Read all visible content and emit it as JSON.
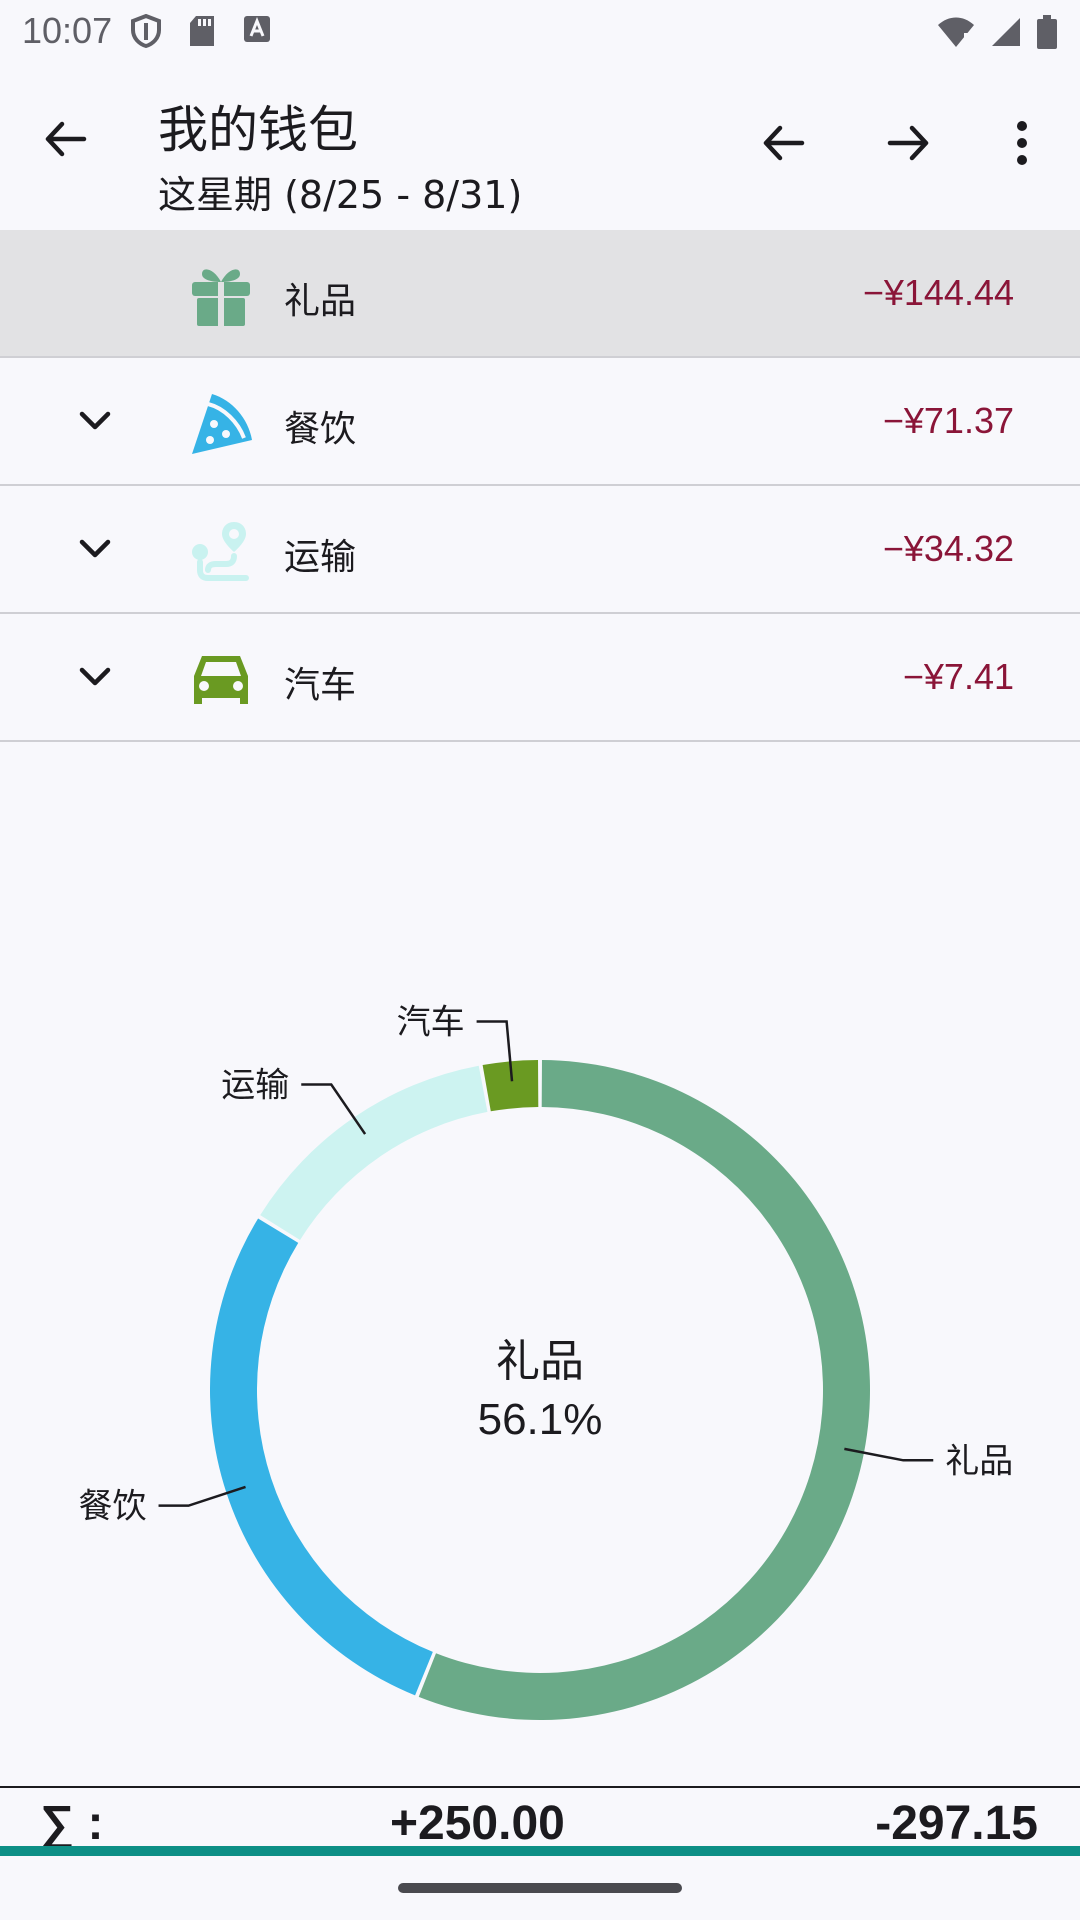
{
  "status_bar": {
    "time": "10:07"
  },
  "toolbar": {
    "title": "我的钱包",
    "subtitle": "这星期 (8/25 - 8/31)"
  },
  "categories": [
    {
      "name": "礼品",
      "amount": "−¥144.44",
      "icon": "gift-icon",
      "color": "#6aaa88",
      "selected": true,
      "expandable": false
    },
    {
      "name": "餐饮",
      "amount": "−¥71.37",
      "icon": "pizza-icon",
      "color": "#36b3e6",
      "selected": false,
      "expandable": true
    },
    {
      "name": "运输",
      "amount": "−¥34.32",
      "icon": "route-icon",
      "color": "#c9f2f0",
      "selected": false,
      "expandable": true
    },
    {
      "name": "汽车",
      "amount": "−¥7.41",
      "icon": "car-icon",
      "color": "#6a9a22",
      "selected": false,
      "expandable": true
    }
  ],
  "chart_data": {
    "type": "pie",
    "center_label": "礼品",
    "center_value": "56.1%",
    "slices": [
      {
        "label": "礼品",
        "value": 144.44,
        "color": "#6aaa88"
      },
      {
        "label": "餐饮",
        "value": 71.37,
        "color": "#36b3e6"
      },
      {
        "label": "运输",
        "value": 34.32,
        "color": "#cdf3f1"
      },
      {
        "label": "汽车",
        "value": 7.41,
        "color": "#6a9a22"
      }
    ]
  },
  "summary": {
    "sigma": "∑ :",
    "income": "+250.00",
    "expense": "-297.15"
  },
  "colors": {
    "amount_negative": "#8a1538",
    "accent": "#0e8f86"
  }
}
